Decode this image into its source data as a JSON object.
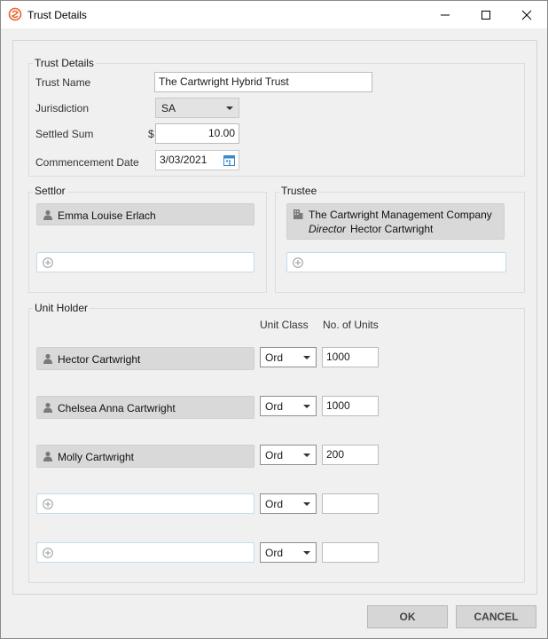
{
  "window": {
    "title": "Trust Details"
  },
  "trust_details": {
    "group_label": "Trust Details",
    "trust_name_label": "Trust Name",
    "trust_name_value": "The Cartwright Hybrid Trust",
    "jurisdiction_label": "Jurisdiction",
    "jurisdiction_value": "SA",
    "settled_sum_label": "Settled Sum",
    "currency_symbol": "$",
    "settled_sum_value": "10.00",
    "commencement_label": "Commencement Date",
    "commencement_value": "3/03/2021"
  },
  "settlor": {
    "group_label": "Settlor",
    "name": "Emma Louise Erlach"
  },
  "trustee": {
    "group_label": "Trustee",
    "company": "The Cartwright Management Company",
    "role": "Director",
    "director_name": "Hector Cartwright"
  },
  "unit_holder": {
    "group_label": "Unit Holder",
    "col_unit_class": "Unit Class",
    "col_units": "No. of Units",
    "rows": [
      {
        "name": "Hector Cartwright",
        "unit_class": "Ord",
        "units": "1000"
      },
      {
        "name": "Chelsea Anna Cartwright",
        "unit_class": "Ord",
        "units": "1000"
      },
      {
        "name": "Molly Cartwright",
        "unit_class": "Ord",
        "units": "200"
      },
      {
        "name": "",
        "unit_class": "Ord",
        "units": ""
      },
      {
        "name": "",
        "unit_class": "Ord",
        "units": ""
      }
    ]
  },
  "buttons": {
    "ok": "OK",
    "cancel": "CANCEL"
  },
  "icons": {
    "app": "app-logo-icon",
    "person": "person-icon",
    "company": "building-icon",
    "add": "add-circle-icon",
    "calendar": "calendar-icon"
  },
  "colors": {
    "app_icon": "#e8622c",
    "chip_bg": "#d9d9d9",
    "add_slot_border": "#c5dbe8"
  }
}
